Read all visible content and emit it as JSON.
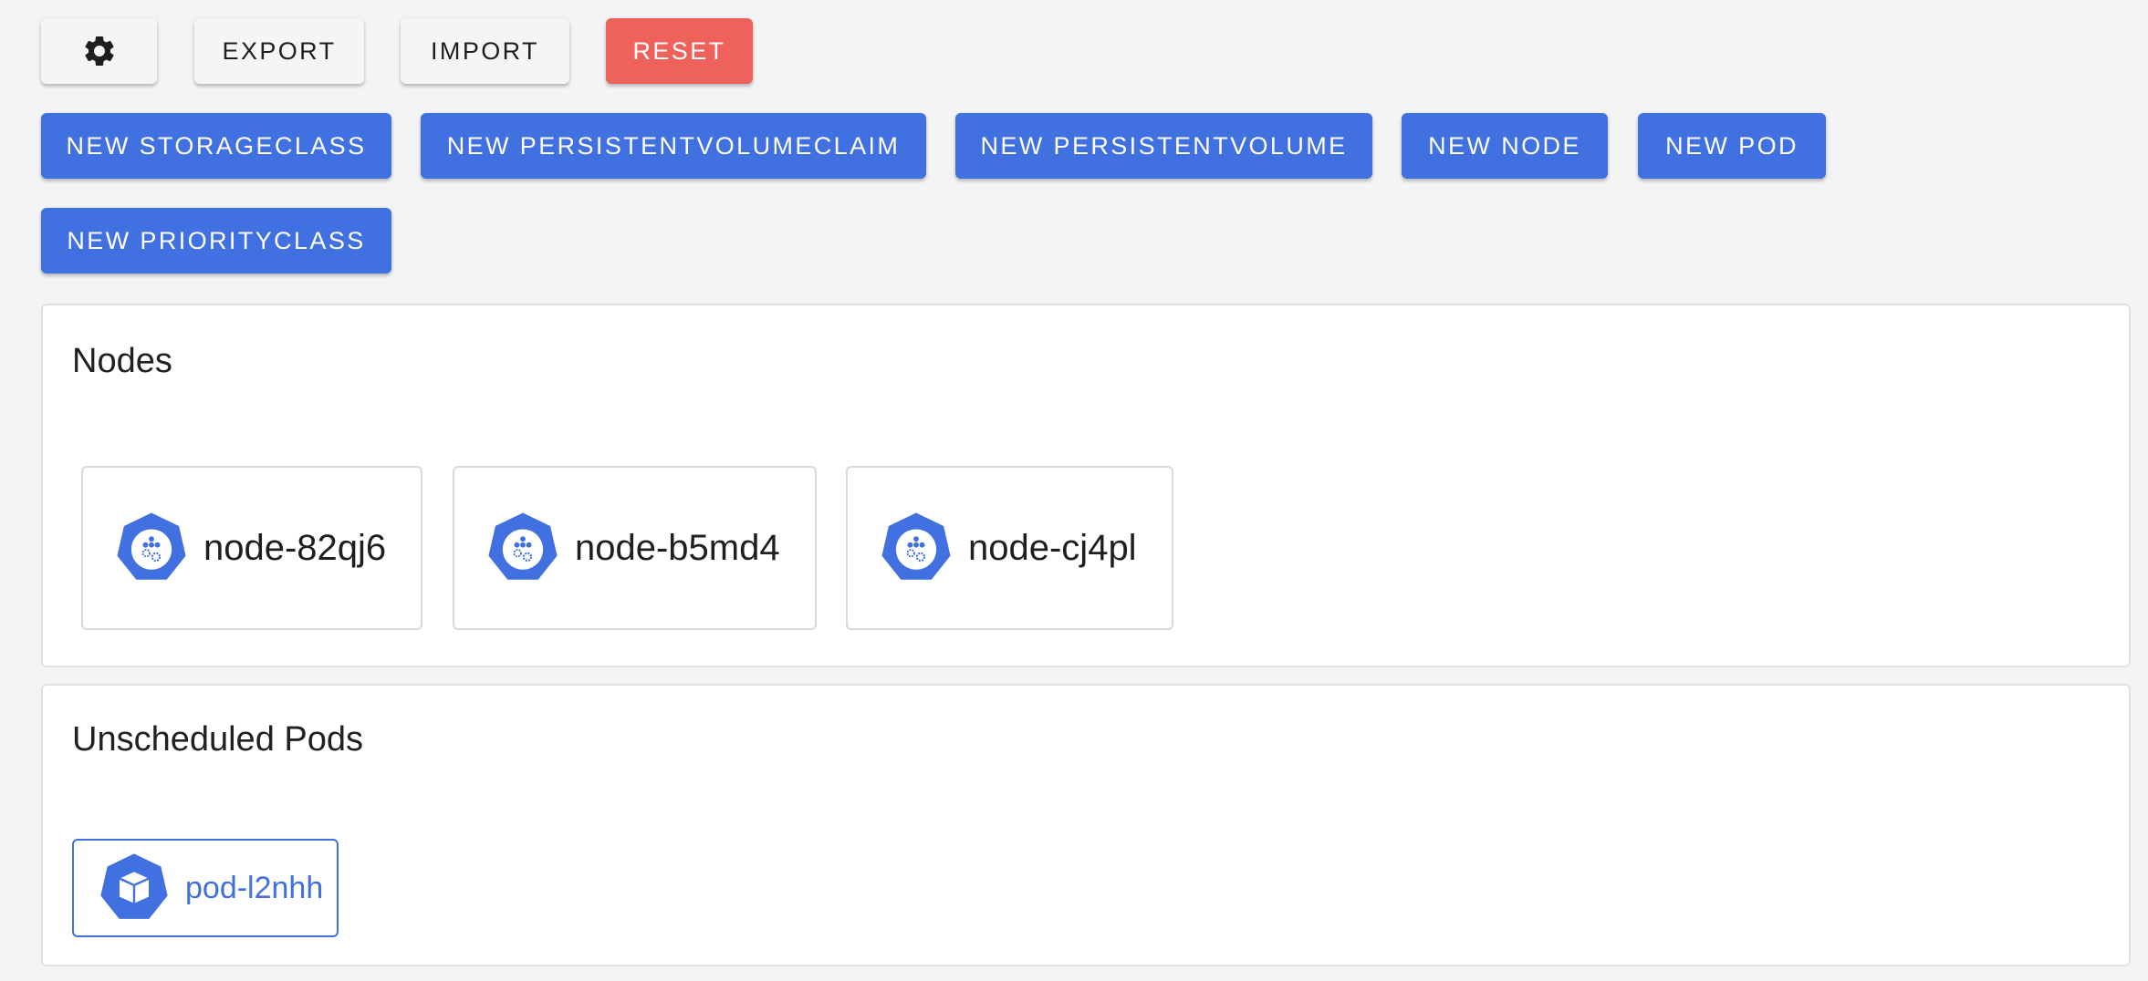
{
  "toolbar": {
    "settings_icon": "gear-icon",
    "export_label": "EXPORT",
    "import_label": "IMPORT",
    "reset_label": "RESET"
  },
  "create_buttons": {
    "storageclass": "NEW STORAGECLASS",
    "persistentvolumeclaim": "NEW PERSISTENTVOLUMECLAIM",
    "persistentvolume": "NEW PERSISTENTVOLUME",
    "node": "NEW NODE",
    "pod": "NEW POD",
    "priorityclass": "NEW PRIORITYCLASS"
  },
  "nodes_panel": {
    "title": "Nodes",
    "items": [
      {
        "name": "node-82qj6",
        "icon": "kubernetes-node-icon"
      },
      {
        "name": "node-b5md4",
        "icon": "kubernetes-node-icon"
      },
      {
        "name": "node-cj4pl",
        "icon": "kubernetes-node-icon"
      }
    ]
  },
  "unscheduled_panel": {
    "title": "Unscheduled Pods",
    "items": [
      {
        "name": "pod-l2nhh",
        "icon": "kubernetes-pod-icon"
      }
    ]
  },
  "colors": {
    "primary": "#4170e0",
    "danger": "#ef625c",
    "background": "#f4f4f4"
  }
}
